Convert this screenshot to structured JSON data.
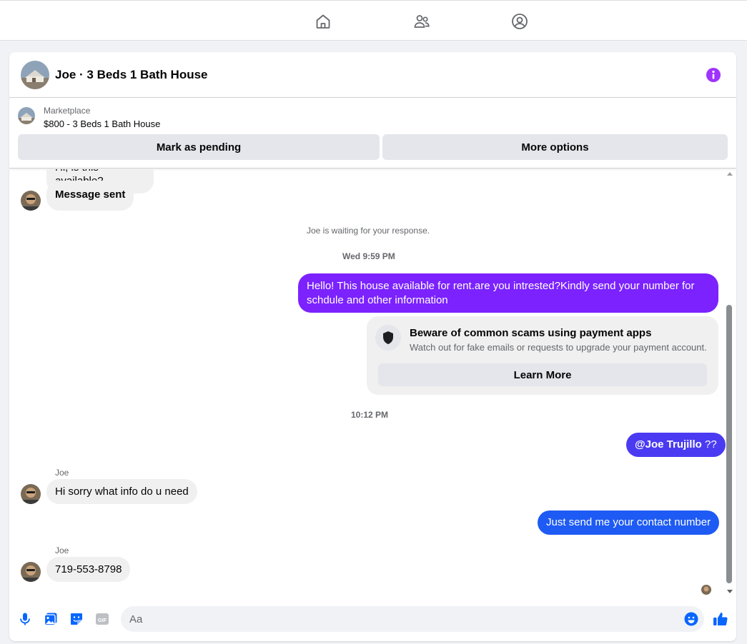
{
  "header": {
    "title": "Joe · 3 Beds 1 Bath House"
  },
  "listing": {
    "source": "Marketplace",
    "title": "$800 - 3 Beds 1 Bath House",
    "mark_pending_label": "Mark as pending",
    "more_options_label": "More options"
  },
  "thread": {
    "partial_message": "Hi, is this available?",
    "message_sent": "Message sent",
    "waiting_note": "Joe is waiting for your response.",
    "timestamp_1": "Wed 9:59 PM",
    "outgoing_1": "Hello! This house available for rent.are you intrested?Kindly send your number for schdule and other information",
    "scam_title": "Beware of common scams using payment apps",
    "scam_desc": "Watch out for fake emails or requests to upgrade your payment account.",
    "learn_more": "Learn More",
    "timestamp_2": "10:12 PM",
    "mention": "@Joe Trujillo",
    "mention_suffix": " ??",
    "sender_1": "Joe",
    "incoming_1": "Hi sorry what info do u need",
    "outgoing_2": "Just send me your contact number",
    "sender_2": "Joe",
    "incoming_2": "719-553-8798"
  },
  "composer": {
    "placeholder": "Aa"
  },
  "colors": {
    "accent_purple": "#a033ff",
    "bubble_purple": "#7b22ff",
    "bubble_indigo": "#4a3bf2",
    "bubble_blue": "#1e5bf4",
    "icon_blue": "#0866ff"
  },
  "icons": [
    "home-icon",
    "friends-icon",
    "profile-icon",
    "info-icon",
    "shield-icon",
    "mic-icon",
    "photo-icon",
    "sticker-icon",
    "gif-icon",
    "emoji-icon",
    "like-icon"
  ]
}
